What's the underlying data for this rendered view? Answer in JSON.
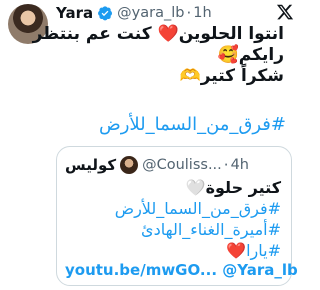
{
  "tweet": {
    "author_name": "Yara",
    "handle": "@yara_lb",
    "separator": "·",
    "time": "1h",
    "lines": [
      "انتوا الحلوين❤️ كنت عم بنتظر",
      "رايكم🥰",
      "شكراً كتير🫶"
    ],
    "hashtag": "#فرق_من_السما_للأرض"
  },
  "quote": {
    "author_name": "كوليس",
    "handle": "@Couliss...",
    "separator": "·",
    "time": "4h",
    "line1": "كتير حلوة🤍",
    "hashtags": [
      "#فرق_من_السما_للأرض",
      "#أميرة_الغناء_الهادئ",
      "#يارا❤️"
    ],
    "link": "youtu.be/mwGO...",
    "mention": "@Yara_lb"
  },
  "icons": {
    "verified": "verified-badge-icon",
    "platform": "x-logo-icon"
  },
  "colors": {
    "link": "#1d9bf0",
    "verified": "#1d9bf0",
    "muted": "#536471",
    "border": "#cfd9de"
  }
}
